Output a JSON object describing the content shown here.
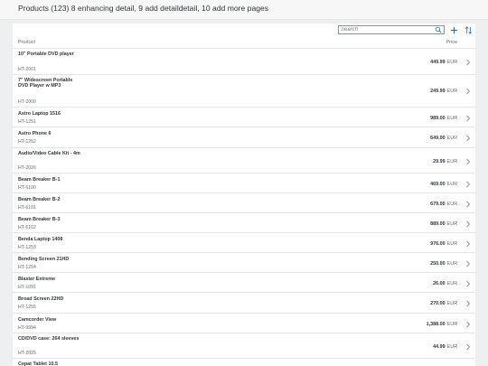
{
  "header": {
    "title": "Products (123) 8 enhancing detail, 9 add detaildetail, 10 add more pages"
  },
  "toolbar": {
    "search_placeholder": "Search",
    "search_icon": "magnifier-icon",
    "add_icon": "plus-icon",
    "sort_icon": "sort-arrows-icon"
  },
  "table": {
    "columns": {
      "product": "Product",
      "price": "Price"
    },
    "rows": [
      {
        "name": "10\" Portable DVD player",
        "code": "HT-2001",
        "amount": "449.99",
        "currency": "EUR"
      },
      {
        "name": "7\" Widescreen Portable DVD Player w MP3",
        "code": "HT-2000",
        "amount": "249.99",
        "currency": "EUR"
      },
      {
        "name": "Astro Laptop 1516",
        "code": "HT-1251",
        "amount": "989.00",
        "currency": "EUR"
      },
      {
        "name": "Astro Phone 6",
        "code": "HT-1252",
        "amount": "649.00",
        "currency": "EUR"
      },
      {
        "name": "Audio/Video Cable Kit - 4m",
        "code": "HT-2026",
        "amount": "29.99",
        "currency": "EUR"
      },
      {
        "name": "Beam Breaker B-1",
        "code": "HT-6100",
        "amount": "469.00",
        "currency": "EUR"
      },
      {
        "name": "Beam Breaker B-2",
        "code": "HT-6101",
        "amount": "679.00",
        "currency": "EUR"
      },
      {
        "name": "Beam Breaker B-3",
        "code": "HT-6102",
        "amount": "889.00",
        "currency": "EUR"
      },
      {
        "name": "Benda Laptop 1408",
        "code": "HT-1253",
        "amount": "976.00",
        "currency": "EUR"
      },
      {
        "name": "Bending Screen 21HD",
        "code": "HT-1254",
        "amount": "250.00",
        "currency": "EUR"
      },
      {
        "name": "Blaster Extreme",
        "code": "HT-1091",
        "amount": "26.00",
        "currency": "EUR"
      },
      {
        "name": "Broad Screen 22HD",
        "code": "HT-1255",
        "amount": "270.00",
        "currency": "EUR"
      },
      {
        "name": "Camcorder View",
        "code": "HT-9994",
        "amount": "1,388.00",
        "currency": "EUR"
      },
      {
        "name": "CD/DVD case: 264 sleeves",
        "code": "HT-2025",
        "amount": "44.99",
        "currency": "EUR"
      },
      {
        "name": "Cepat Tablet 10.5",
        "code": "",
        "amount": "",
        "currency": ""
      }
    ]
  },
  "colors": {
    "accent": "#0a6ed1",
    "background": "#edeff0",
    "panel": "#ffffff",
    "text": "#32363a",
    "secondary_text": "#6a6d70"
  }
}
